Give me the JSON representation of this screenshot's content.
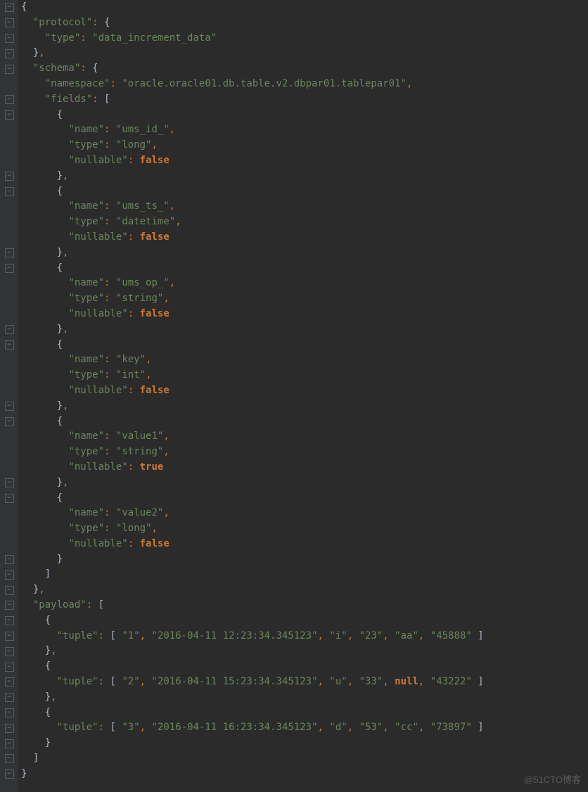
{
  "watermark": "@51CTO博客",
  "code": {
    "protocol_key": "\"protocol\"",
    "type_key": "\"type\"",
    "protocol_type_value": "\"data_increment_data\"",
    "schema_key": "\"schema\"",
    "namespace_key": "\"namespace\"",
    "namespace_value": "\"oracle.oracle01.db.table.v2.dbpar01.tablepar01\"",
    "fields_key": "\"fields\"",
    "name_key": "\"name\"",
    "nullable_key": "\"nullable\"",
    "payload_key": "\"payload\"",
    "tuple_key": "\"tuple\"",
    "false_kw": "false",
    "true_kw": "true",
    "null_kw": "null",
    "f0_name": "\"ums_id_\"",
    "f0_type": "\"long\"",
    "f1_name": "\"ums_ts_\"",
    "f1_type": "\"datetime\"",
    "f2_name": "\"ums_op_\"",
    "f2_type": "\"string\"",
    "f3_name": "\"key\"",
    "f3_type": "\"int\"",
    "f4_name": "\"value1\"",
    "f4_type": "\"string\"",
    "f5_name": "\"value2\"",
    "f5_type": "\"long\"",
    "p0": {
      "v0": "\"1\"",
      "v1": "\"2016-04-11 12:23:34.345123\"",
      "v2": "\"i\"",
      "v3": "\"23\"",
      "v4": "\"aa\"",
      "v5": "\"45888\""
    },
    "p1": {
      "v0": "\"2\"",
      "v1": "\"2016-04-11 15:23:34.345123\"",
      "v2": "\"u\"",
      "v3": "\"33\"",
      "v5": "\"43222\""
    },
    "p2": {
      "v0": "\"3\"",
      "v1": "\"2016-04-11 16:23:34.345123\"",
      "v2": "\"d\"",
      "v3": "\"53\"",
      "v4": "\"cc\"",
      "v5": "\"73897\""
    }
  }
}
